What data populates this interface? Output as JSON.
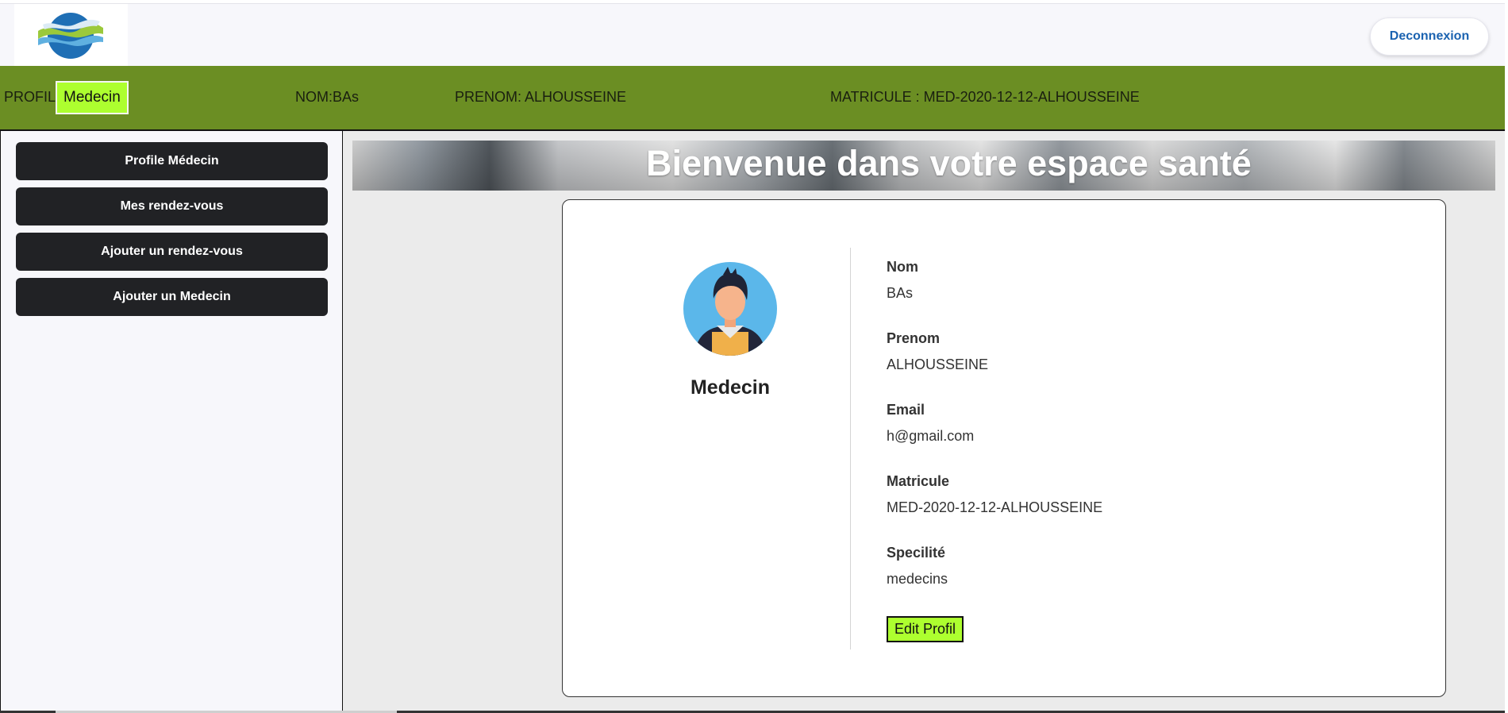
{
  "header": {
    "logo_icon": "waves-logo-icon",
    "logout_label": "Deconnexion",
    "accent_color": "#1a62b0"
  },
  "infobar": {
    "profil_label": "PROFIL:",
    "profil_value": "Medecin",
    "nom": "NOM:BAs",
    "prenom": "PRENOM: ALHOUSSEINE",
    "matricule": "MATRICULE : MED-2020-12-12-ALHOUSSEINE",
    "bar_color": "#6b8e23",
    "badge_color": "#adff2f"
  },
  "sidebar": {
    "items": [
      {
        "label": "Profile Médecin"
      },
      {
        "label": "Mes rendez-vous"
      },
      {
        "label": "Ajouter un rendez-vous"
      },
      {
        "label": "Ajouter un Medecin"
      }
    ]
  },
  "main": {
    "banner_title": "Bienvenue dans votre espace santé",
    "profile": {
      "avatar_icon": "doctor-avatar-icon",
      "role": "Medecin",
      "fields": [
        {
          "label": "Nom",
          "value": "BAs"
        },
        {
          "label": "Prenom",
          "value": "ALHOUSSEINE"
        },
        {
          "label": "Email",
          "value": "h@gmail.com"
        },
        {
          "label": "Matricule",
          "value": "MED-2020-12-12-ALHOUSSEINE"
        },
        {
          "label": "Specilité",
          "value": "medecins"
        }
      ],
      "edit_label": "Edit Profil"
    }
  }
}
